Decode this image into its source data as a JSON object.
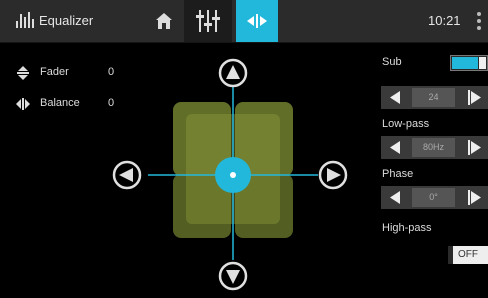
{
  "header": {
    "title": "Equalizer",
    "clock": "10:21",
    "tabs": [
      {
        "icon": "equalizer-sliders-icon",
        "active": false
      },
      {
        "icon": "balance-arrows-icon",
        "active": true
      }
    ],
    "home_icon": "home-icon",
    "settings_icon": "settings-icon"
  },
  "controls": {
    "fader": {
      "label": "Fader",
      "value": "0",
      "icon": "fader-arrows-icon"
    },
    "balance": {
      "label": "Balance",
      "value": "0",
      "icon": "balance-arrows-icon"
    }
  },
  "position_pad": {
    "fader": 0,
    "balance": 0,
    "up_icon": "arrow-up-icon",
    "down_icon": "arrow-down-icon",
    "left_icon": "arrow-left-icon",
    "right_icon": "arrow-right-icon"
  },
  "sidebar": {
    "sub_label": "Sub",
    "sub_enabled": true,
    "sub_level": "24",
    "low_pass_label": "Low-pass",
    "low_pass_value": "80Hz",
    "phase_label": "Phase",
    "phase_value": "0°",
    "high_pass_label": "High-pass",
    "high_pass_value": "OFF"
  },
  "colors": {
    "accent": "#22b8dc",
    "header_bg": "#2b2b2b",
    "speaker_fill": "#6b7a2c",
    "speaker_inner": "#8a9a3a"
  }
}
